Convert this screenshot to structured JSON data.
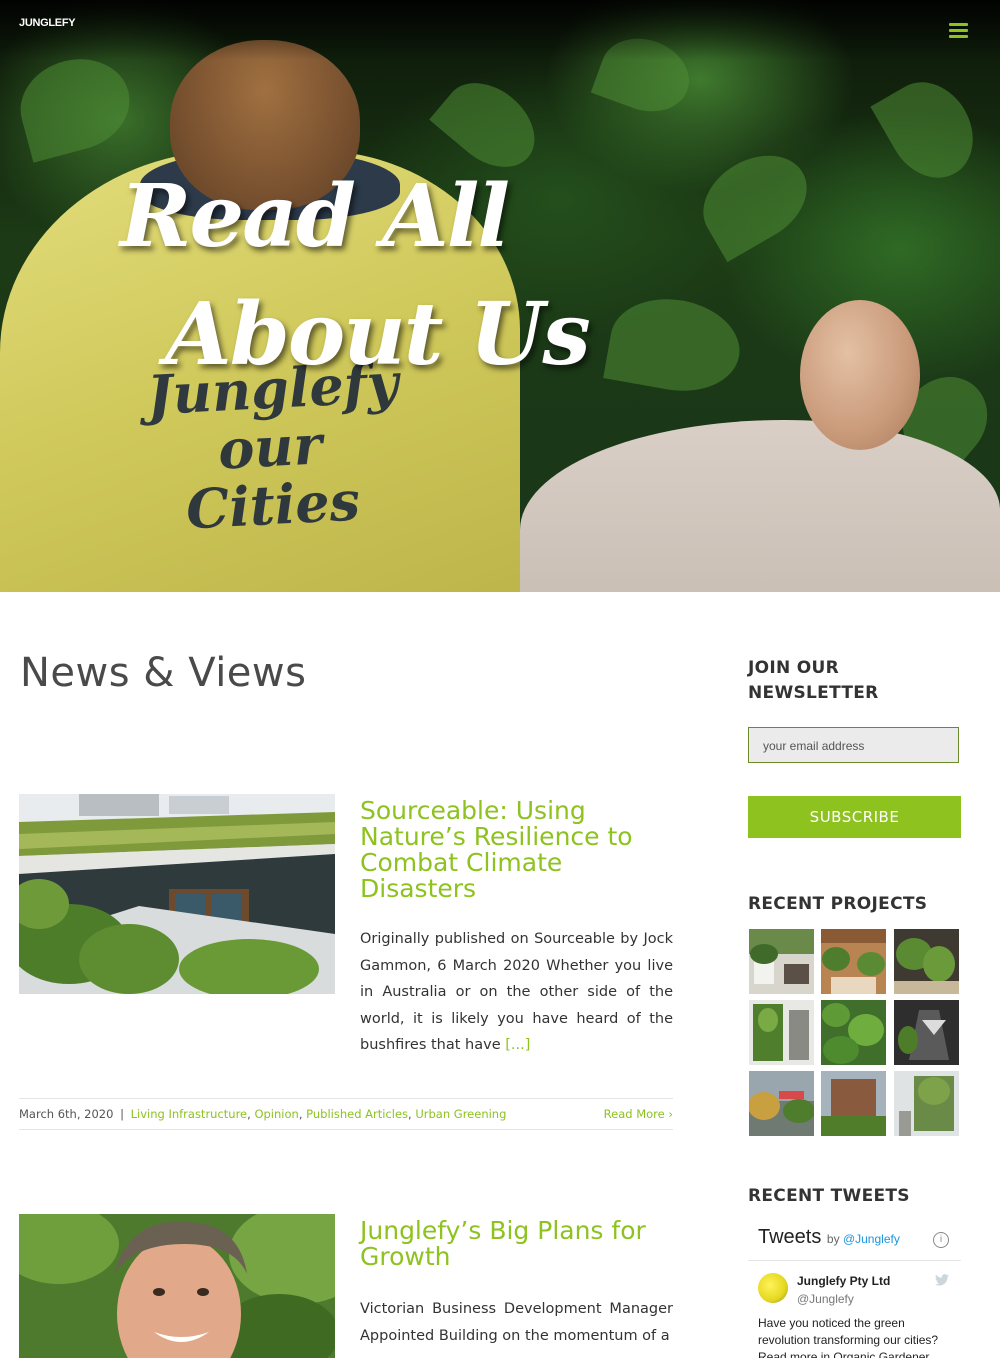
{
  "header": {
    "logo": "JUNGLEFY",
    "menu_icon": "hamburger-menu-icon"
  },
  "hero": {
    "title_line1": "Read All",
    "title_line2": "About Us",
    "shirt_text": "Junglefy our Cities"
  },
  "main": {
    "page_title": "News & Views",
    "posts": [
      {
        "title": "Sourceable: Using Nature’s Resilience to Combat Climate Disasters",
        "excerpt": "Originally published on Sourceable by Jock Gammon, 6 March 2020 Whether you live in Australia or on the other side of the world, it is likely you have heard of the bushfires that have",
        "more": "[...]",
        "date": "March 6th, 2020",
        "separator": "|",
        "categories": [
          "Living Infrastructure",
          "Opinion",
          "Published Articles",
          "Urban Greening"
        ],
        "read_more": "Read More"
      },
      {
        "title": "Junglefy’s Big Plans for Growth",
        "excerpt": "Victorian Business Development Manager Appointed Building on the momentum of a"
      }
    ]
  },
  "sidebar": {
    "newsletter": {
      "heading_line1": "JOIN OUR",
      "heading_line2": "NEWSLETTER",
      "placeholder": "your email address",
      "button": "SUBSCRIBE"
    },
    "projects": {
      "heading": "RECENT PROJECTS"
    },
    "tweets": {
      "heading": "RECENT TWEETS",
      "widget_title": "Tweets",
      "by": "by",
      "handle_link": "@Junglefy",
      "info": "i",
      "account_name": "Junglefy Pty Ltd",
      "account_handle": "@Junglefy",
      "tweet_text": "Have you noticed the green revolution transforming our cities? Read more in Organic Gardener"
    }
  },
  "colors": {
    "accent": "#8dc21f",
    "text": "#333333",
    "link": "#1b95e0"
  }
}
